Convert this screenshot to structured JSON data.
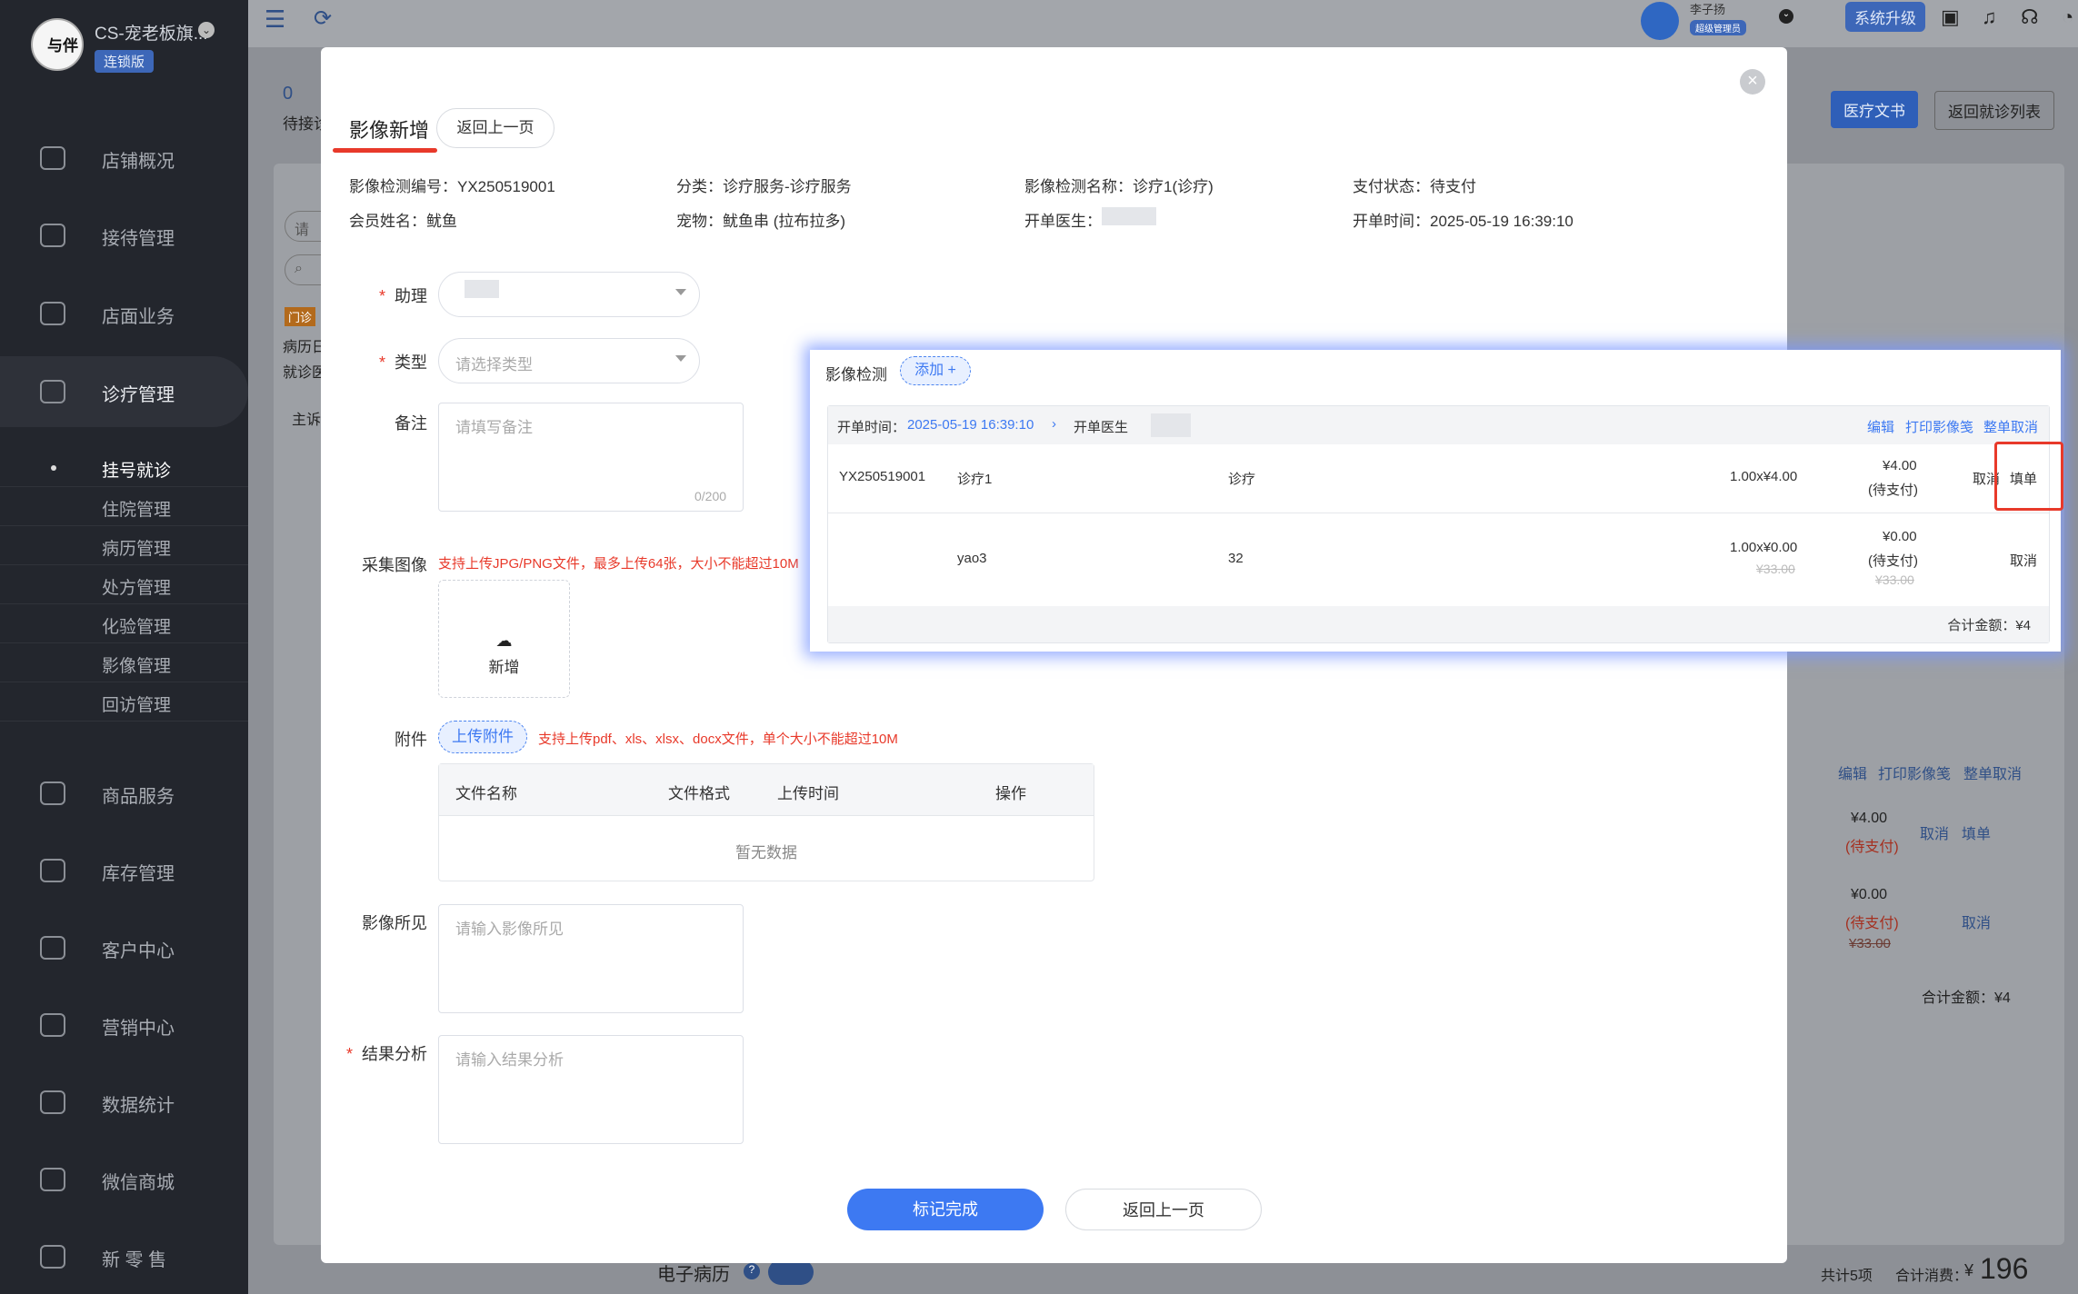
{
  "sidebar": {
    "store_name": "CS-宠老板旗...",
    "edition": "连锁版",
    "logo_text": "与伴",
    "items": [
      {
        "label": "店铺概况",
        "icon": "dashboard-icon"
      },
      {
        "label": "接待管理",
        "icon": "reception-icon"
      },
      {
        "label": "店面业务",
        "icon": "store-icon"
      },
      {
        "label": "诊疗管理",
        "icon": "medical-kit-icon"
      },
      {
        "label": "商品服务",
        "icon": "shopping-bag-icon"
      },
      {
        "label": "库存管理",
        "icon": "inventory-icon"
      },
      {
        "label": "客户中心",
        "icon": "customer-icon"
      },
      {
        "label": "营销中心",
        "icon": "marketing-icon"
      },
      {
        "label": "数据统计",
        "icon": "statistics-icon"
      },
      {
        "label": "微信商城",
        "icon": "wechat-mall-icon"
      },
      {
        "label": "新 零 售",
        "icon": "retail-box-icon"
      }
    ],
    "subitems": [
      "挂号就诊",
      "住院管理",
      "病历管理",
      "处方管理",
      "化验管理",
      "影像管理",
      "回访管理"
    ]
  },
  "topbar": {
    "user_name": "李子扬",
    "user_role": "超级管理员",
    "upgrade_label": "系统升级"
  },
  "background": {
    "count": "0",
    "count_label": "待接诊",
    "medical_doc_btn": "医疗文书",
    "back_list_btn": "返回就诊列表",
    "search_placeholder": "请",
    "tag": "门诊",
    "text1": "病历日",
    "text2": "就诊医",
    "text3": "主诉",
    "edit": "编辑",
    "print": "打印影像笺",
    "cancel_all": "整单取消",
    "price1": "¥4.00",
    "status1": "(待支付)",
    "cancel": "取消",
    "fill": "填单",
    "price2": "¥0.00",
    "status2": "(待支付)",
    "strike2": "¥33.00",
    "total": "合计金额：¥4",
    "emr_label": "电子病历",
    "footer_count": "共计5项",
    "footer_total_label": "合计消费：",
    "footer_currency": "¥",
    "footer_total": "196"
  },
  "modal": {
    "title": "影像新增",
    "back_top": "返回上一页",
    "info": {
      "code": "影像检测编号：YX250519001",
      "category": "分类：诊疗服务-诊疗服务",
      "name": "影像检测名称：诊疗1(诊疗)",
      "pay_status": "支付状态：待支付",
      "member": "会员姓名：鱿鱼",
      "pet": "宠物：鱿鱼串 (拉布拉多)",
      "doctor": "开单医生：",
      "time": "开单时间：2025-05-19 16:39:10"
    },
    "form": {
      "assistant_label": "助理",
      "type_label": "类型",
      "type_placeholder": "请选择类型",
      "remark_label": "备注",
      "remark_placeholder": "请填写备注",
      "remark_counter": "0/200",
      "image_label": "采集图像",
      "image_hint": "支持上传JPG/PNG文件，最多上传64张，大小不能超过10M",
      "upload_label": "新增",
      "attach_label": "附件",
      "attach_btn": "上传附件",
      "attach_hint": "支持上传pdf、xls、xlsx、docx文件，单个大小不能超过10M",
      "table_headers": [
        "文件名称",
        "文件格式",
        "上传时间",
        "操作"
      ],
      "empty_text": "暂无数据",
      "finding_label": "影像所见",
      "finding_placeholder": "请输入影像所见",
      "result_label": "结果分析",
      "result_placeholder": "请输入结果分析"
    },
    "submit": "标记完成",
    "back_bottom": "返回上一页"
  },
  "popup": {
    "title": "影像检测",
    "add": "添加 +",
    "open_time_label": "开单时间：",
    "open_time": "2025-05-19 16:39:10",
    "doctor_label": "开单医生",
    "edit": "编辑",
    "print": "打印影像笺",
    "cancel_all": "整单取消",
    "rows": [
      {
        "code": "YX250519001",
        "name": "诊疗1",
        "type": "诊疗",
        "qty": "1.00x¥4.00",
        "price": "¥4.00",
        "status": "(待支付)",
        "strike_qty": "",
        "strike_price": "",
        "cancel": "取消",
        "fill": "填单"
      },
      {
        "code": "",
        "name": "yao3",
        "type": "32",
        "qty": "1.00x¥0.00",
        "price": "¥0.00",
        "status": "(待支付)",
        "strike_qty": "¥33.00",
        "strike_price": "¥33.00",
        "cancel": "取消",
        "fill": ""
      }
    ],
    "total": "合计金额：¥4"
  },
  "colors": {
    "accent": "#3d79f2",
    "danger": "#e8392a",
    "sidebar": "#23262d"
  }
}
